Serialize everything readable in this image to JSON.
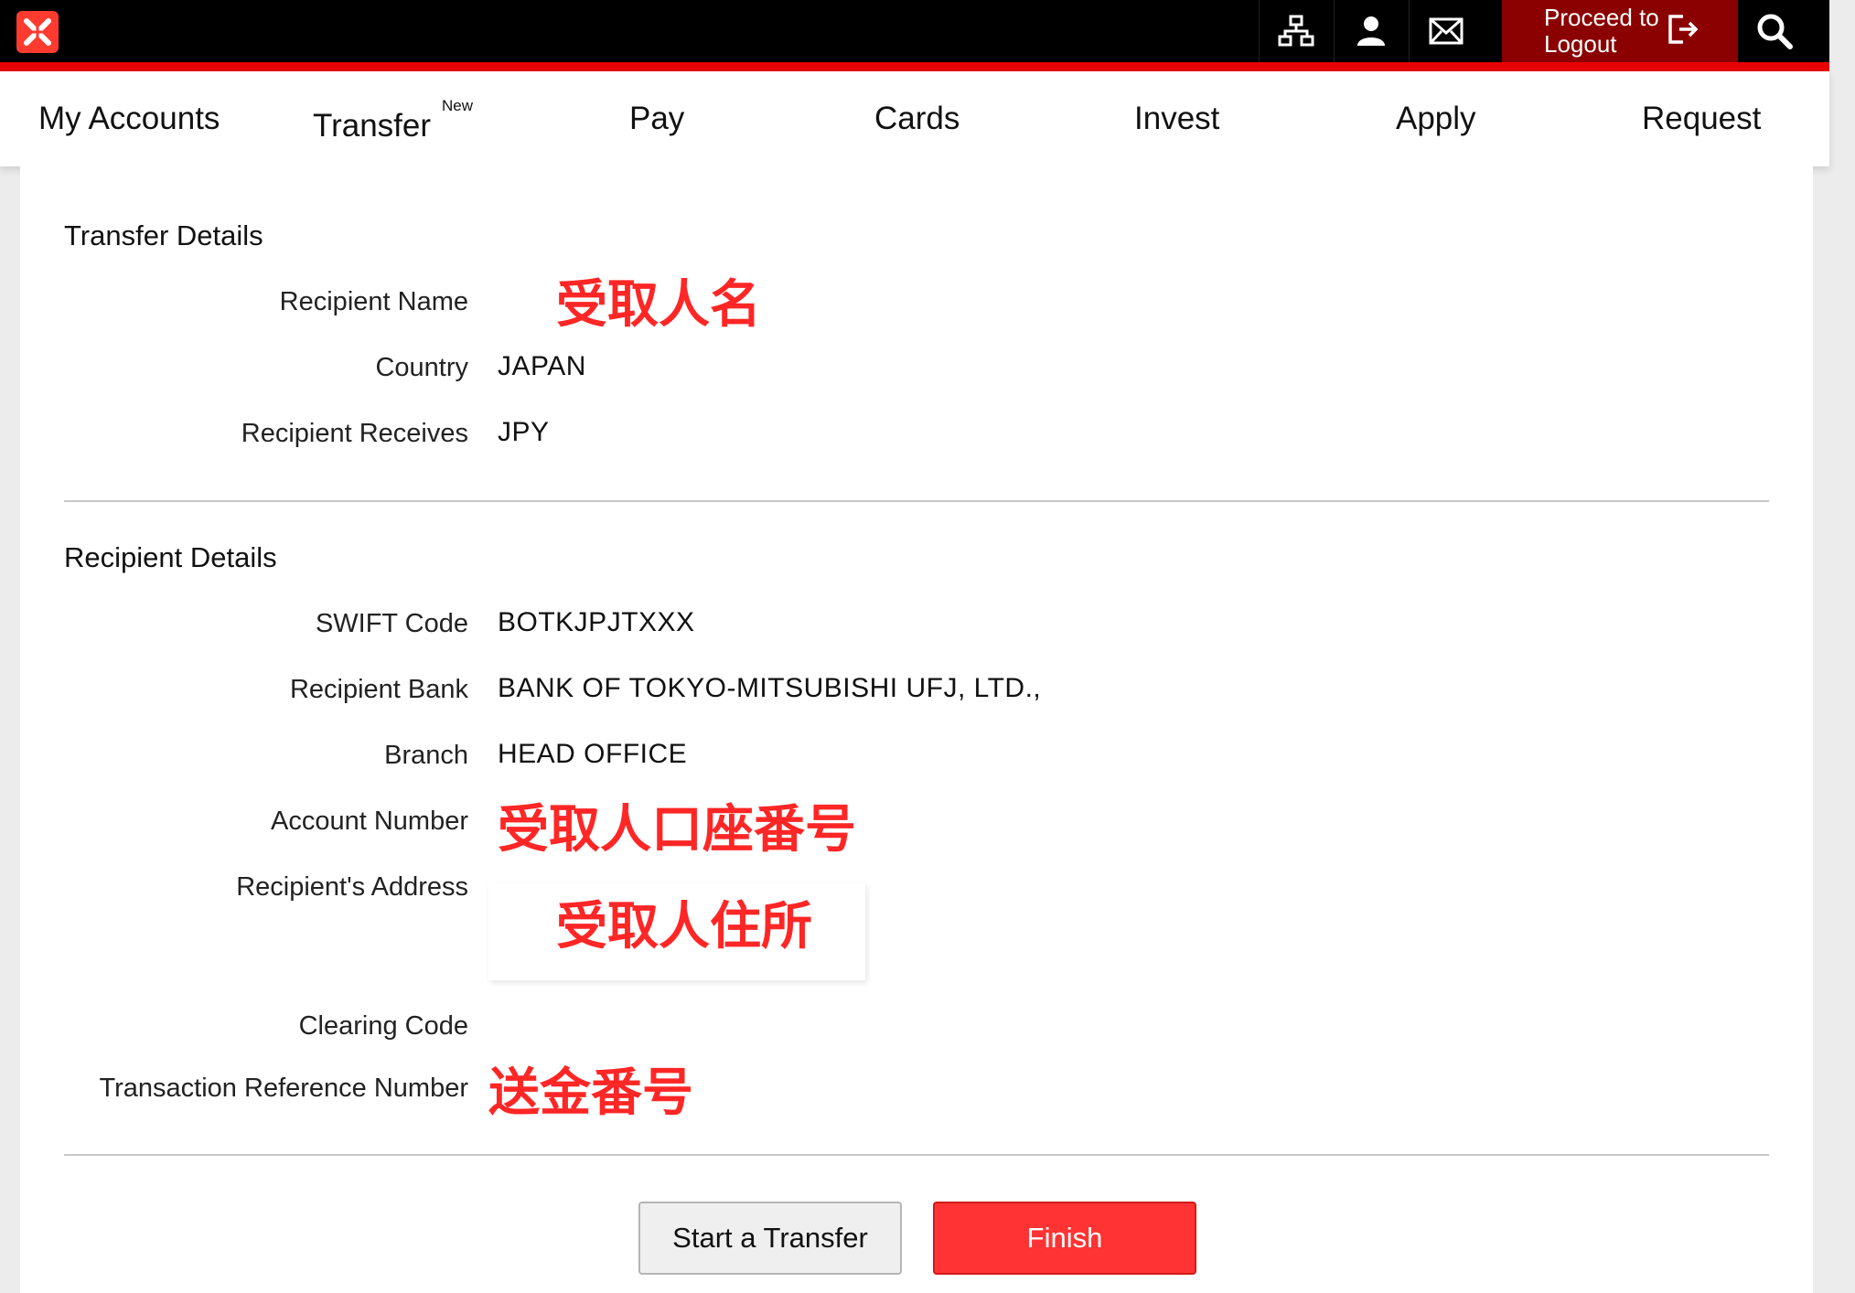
{
  "header": {
    "logo_icon": "bank-logo-icon",
    "icons": [
      "sitemap-icon",
      "user-icon",
      "mail-icon",
      "search-icon"
    ],
    "logout_label_1": "Proceed to",
    "logout_label_2": "Logout",
    "accent_color": "#e60000"
  },
  "nav": {
    "items": [
      {
        "label": "My Accounts"
      },
      {
        "label": "Transfer",
        "badge": "New"
      },
      {
        "label": "Pay"
      },
      {
        "label": "Cards"
      },
      {
        "label": "Invest"
      },
      {
        "label": "Apply"
      },
      {
        "label": "Request"
      }
    ]
  },
  "transfer_details": {
    "title": "Transfer Details",
    "recipient_name_label": "Recipient Name",
    "recipient_name_value": "受取人名",
    "country_label": "Country",
    "country_value": "JAPAN",
    "receives_label": "Recipient Receives",
    "receives_value": "JPY"
  },
  "recipient_details": {
    "title": "Recipient Details",
    "swift_label": "SWIFT Code",
    "swift_value": "BOTKJPJTXXX",
    "bank_label": "Recipient Bank",
    "bank_value": "BANK OF TOKYO-MITSUBISHI UFJ, LTD.,",
    "branch_label": "Branch",
    "branch_value": "HEAD OFFICE",
    "account_label": "Account Number",
    "account_value": "受取人口座番号",
    "address_label": "Recipient's Address",
    "address_value": "受取人住所",
    "clearing_label": "Clearing Code",
    "reference_label": "Transaction Reference Number",
    "reference_value": "送金番号"
  },
  "actions": {
    "start_label": "Start a Transfer",
    "finish_label": "Finish"
  }
}
